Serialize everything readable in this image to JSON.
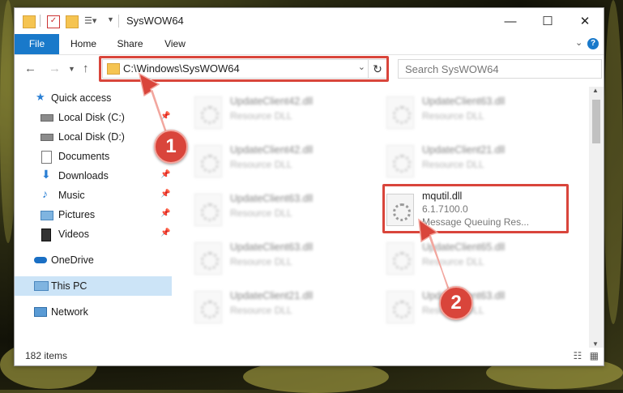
{
  "window": {
    "title": "SysWOW64",
    "controls": {
      "minimize": "—",
      "maximize": "☐",
      "close": "✕"
    }
  },
  "ribbon": {
    "tabs": [
      {
        "label": "File",
        "active": true
      },
      {
        "label": "Home"
      },
      {
        "label": "Share"
      },
      {
        "label": "View"
      }
    ],
    "expand_icon": "chevron-down-icon",
    "help_icon": "help-icon"
  },
  "navigation": {
    "back_icon": "back-arrow-icon",
    "forward_icon": "forward-arrow-icon",
    "recent_icon": "chevron-down-icon",
    "up_icon": "up-arrow-icon",
    "address": "C:\\Windows\\SysWOW64",
    "search_placeholder": "Search SysWOW64"
  },
  "sidebar": {
    "items": [
      {
        "label": "Quick access",
        "icon": "star-icon",
        "pinned": false
      },
      {
        "label": "Local Disk (C:)",
        "icon": "drive-icon",
        "pinned": true
      },
      {
        "label": "Local Disk (D:)",
        "icon": "drive-icon",
        "pinned": false
      },
      {
        "label": "Documents",
        "icon": "documents-icon",
        "pinned": true
      },
      {
        "label": "Downloads",
        "icon": "download-icon",
        "pinned": true
      },
      {
        "label": "Music",
        "icon": "music-icon",
        "pinned": true
      },
      {
        "label": "Pictures",
        "icon": "pictures-icon",
        "pinned": true
      },
      {
        "label": "Videos",
        "icon": "videos-icon",
        "pinned": true
      },
      {
        "label": "OneDrive",
        "icon": "cloud-icon",
        "pinned": false
      },
      {
        "label": "This PC",
        "icon": "computer-icon",
        "selected": true
      },
      {
        "label": "Network",
        "icon": "network-icon",
        "pinned": false
      }
    ]
  },
  "files": {
    "left_column": [
      {
        "name": "UpdateClient42.dll",
        "type": "Resource DLL"
      },
      {
        "name": "UpdateClient42.dll",
        "type": "Resource DLL"
      },
      {
        "name": "UpdateClient63.dll",
        "type": "Resource DLL"
      },
      {
        "name": "UpdateClient63.dll",
        "type": "Resource DLL"
      },
      {
        "name": "UpdateClient21.dll",
        "type": "Resource DLL"
      }
    ],
    "right_column": [
      {
        "name": "UpdateClient63.dll",
        "type": "Resource DLL"
      },
      {
        "name": "UpdateClient21.dll",
        "type": "Resource DLL"
      },
      {
        "name": "mqutil.dll",
        "version": "6.1.7100.0",
        "description": "Message Queuing Res..."
      },
      {
        "name": "UpdateClient65.dll",
        "type": "Resource DLL"
      },
      {
        "name": "UpdateClient63.dll",
        "type": "Resource DLL"
      }
    ]
  },
  "status": {
    "item_count": "182 items"
  },
  "annotations": {
    "step1": "1",
    "step2": "2",
    "color": "#d9453b"
  }
}
